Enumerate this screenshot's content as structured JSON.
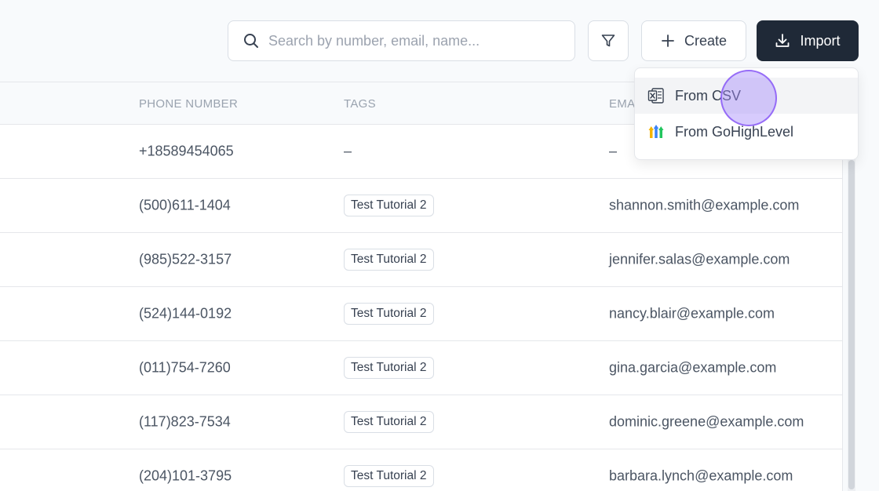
{
  "toolbar": {
    "search_placeholder": "Search by number, email, name...",
    "create_label": "Create",
    "import_label": "Import"
  },
  "table": {
    "headers": [
      "PHONE NUMBER",
      "TAGS",
      "EMA"
    ],
    "rows": [
      {
        "phone": "+18589454065",
        "tag": "",
        "tag_text": "–",
        "email": "–"
      },
      {
        "phone": "(500)611-1404",
        "tag": "Test Tutorial 2",
        "email": "shannon.smith@example.com"
      },
      {
        "phone": "(985)522-3157",
        "tag": "Test Tutorial 2",
        "email": "jennifer.salas@example.com"
      },
      {
        "phone": "(524)144-0192",
        "tag": "Test Tutorial 2",
        "email": "nancy.blair@example.com"
      },
      {
        "phone": "(011)754-7260",
        "tag": "Test Tutorial 2",
        "email": "gina.garcia@example.com"
      },
      {
        "phone": "(117)823-7534",
        "tag": "Test Tutorial 2",
        "email": "dominic.greene@example.com"
      },
      {
        "phone": "(204)101-3795",
        "tag": "Test Tutorial 2",
        "email": "barbara.lynch@example.com"
      }
    ]
  },
  "import_menu": {
    "items": [
      {
        "label": "From CSV",
        "icon": "excel-icon"
      },
      {
        "label": "From GoHighLevel",
        "icon": "gohighlevel-icon"
      }
    ]
  },
  "colors": {
    "primary_button": "#1f2937",
    "background": "#f8fafc",
    "cursor_highlight": "#a78bfa"
  }
}
